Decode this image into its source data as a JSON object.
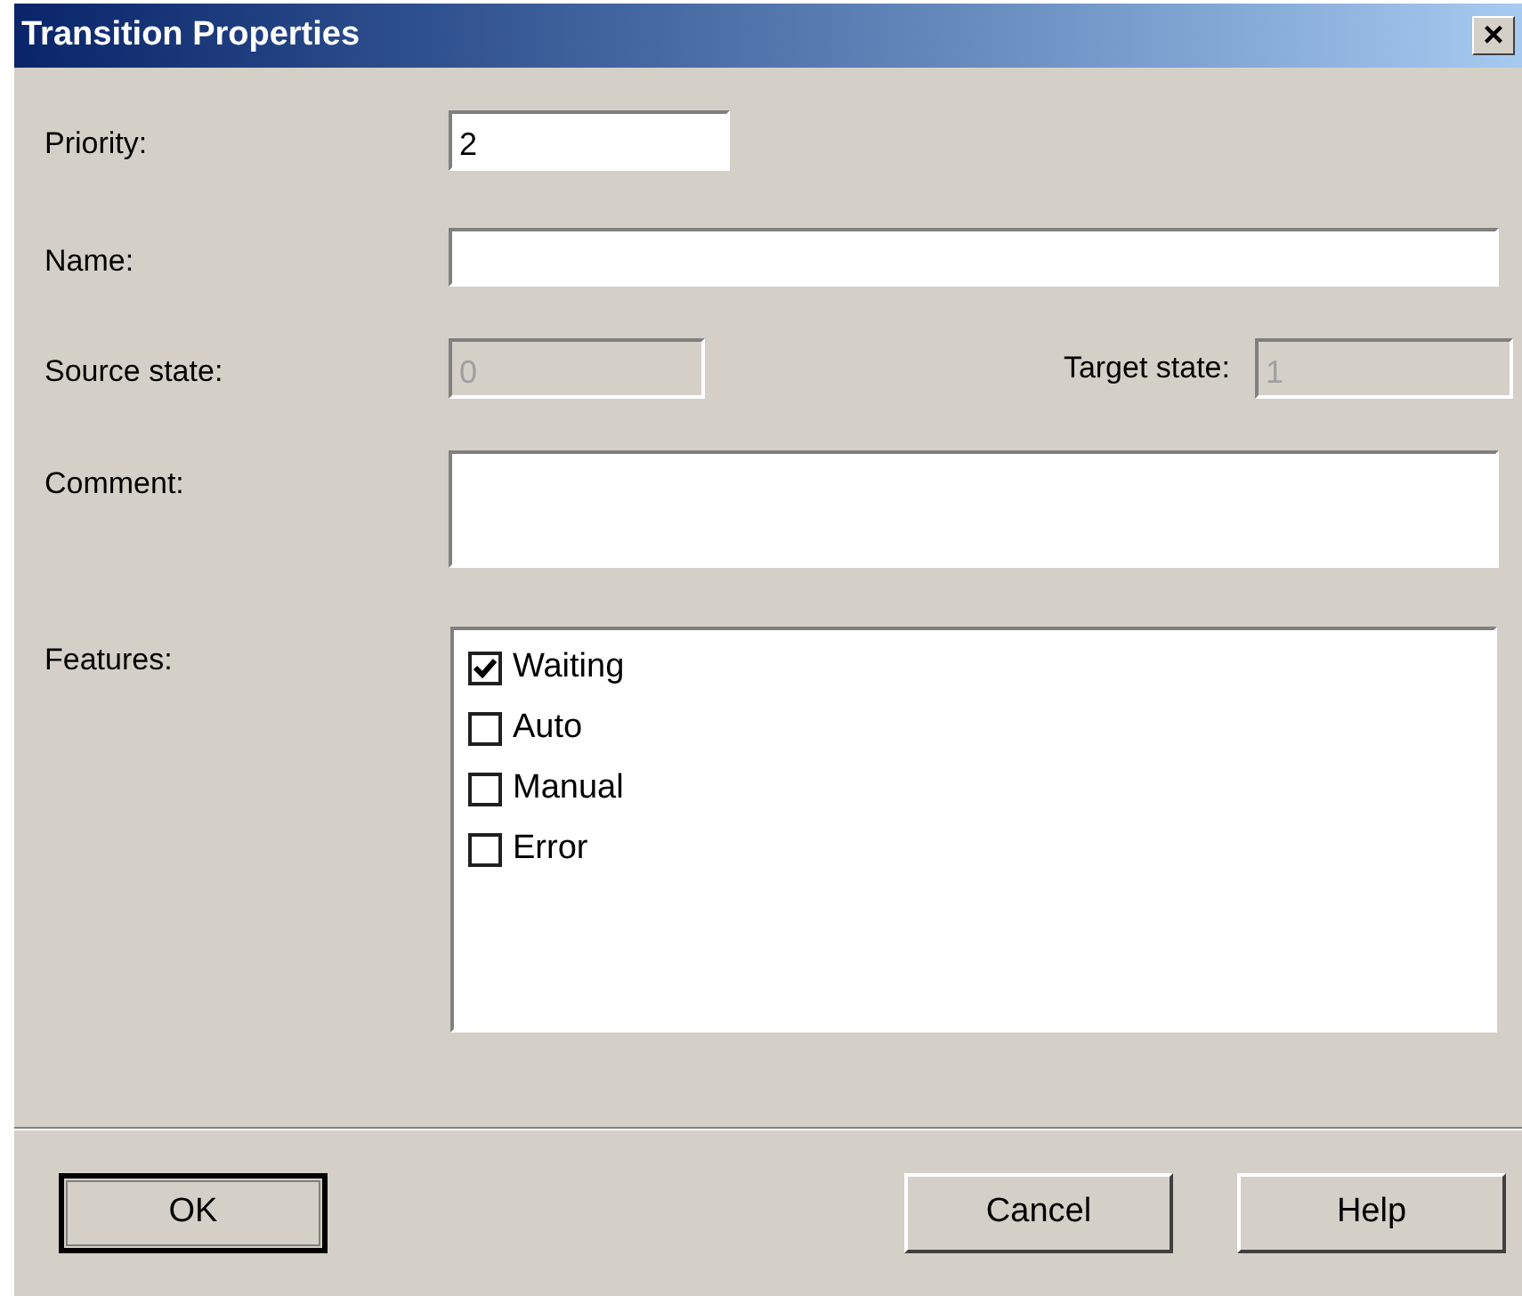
{
  "window": {
    "title": "Transition Properties",
    "close": "×"
  },
  "priority": {
    "label": "Priority:",
    "value": "2",
    "disabled": false
  },
  "name": {
    "label": "Name:",
    "disabled": false
  },
  "source_state": {
    "label": "Source state:",
    "value": "0",
    "disabled": true
  },
  "target_state": {
    "label": "Target state:",
    "value": "1",
    "disabled": true
  },
  "comment": {
    "label": "Comment:",
    "disabled": false
  },
  "features": {
    "label": "Features:",
    "items": [
      {
        "label": "Waiting",
        "checked": true
      },
      {
        "label": "Auto",
        "checked": false
      },
      {
        "label": "Manual",
        "checked": false
      },
      {
        "label": "Error",
        "checked": false
      }
    ]
  },
  "buttons": [
    {
      "label": "OK",
      "default": true
    },
    {
      "label": "Cancel",
      "default": false
    },
    {
      "label": "Help",
      "default": false
    }
  ]
}
